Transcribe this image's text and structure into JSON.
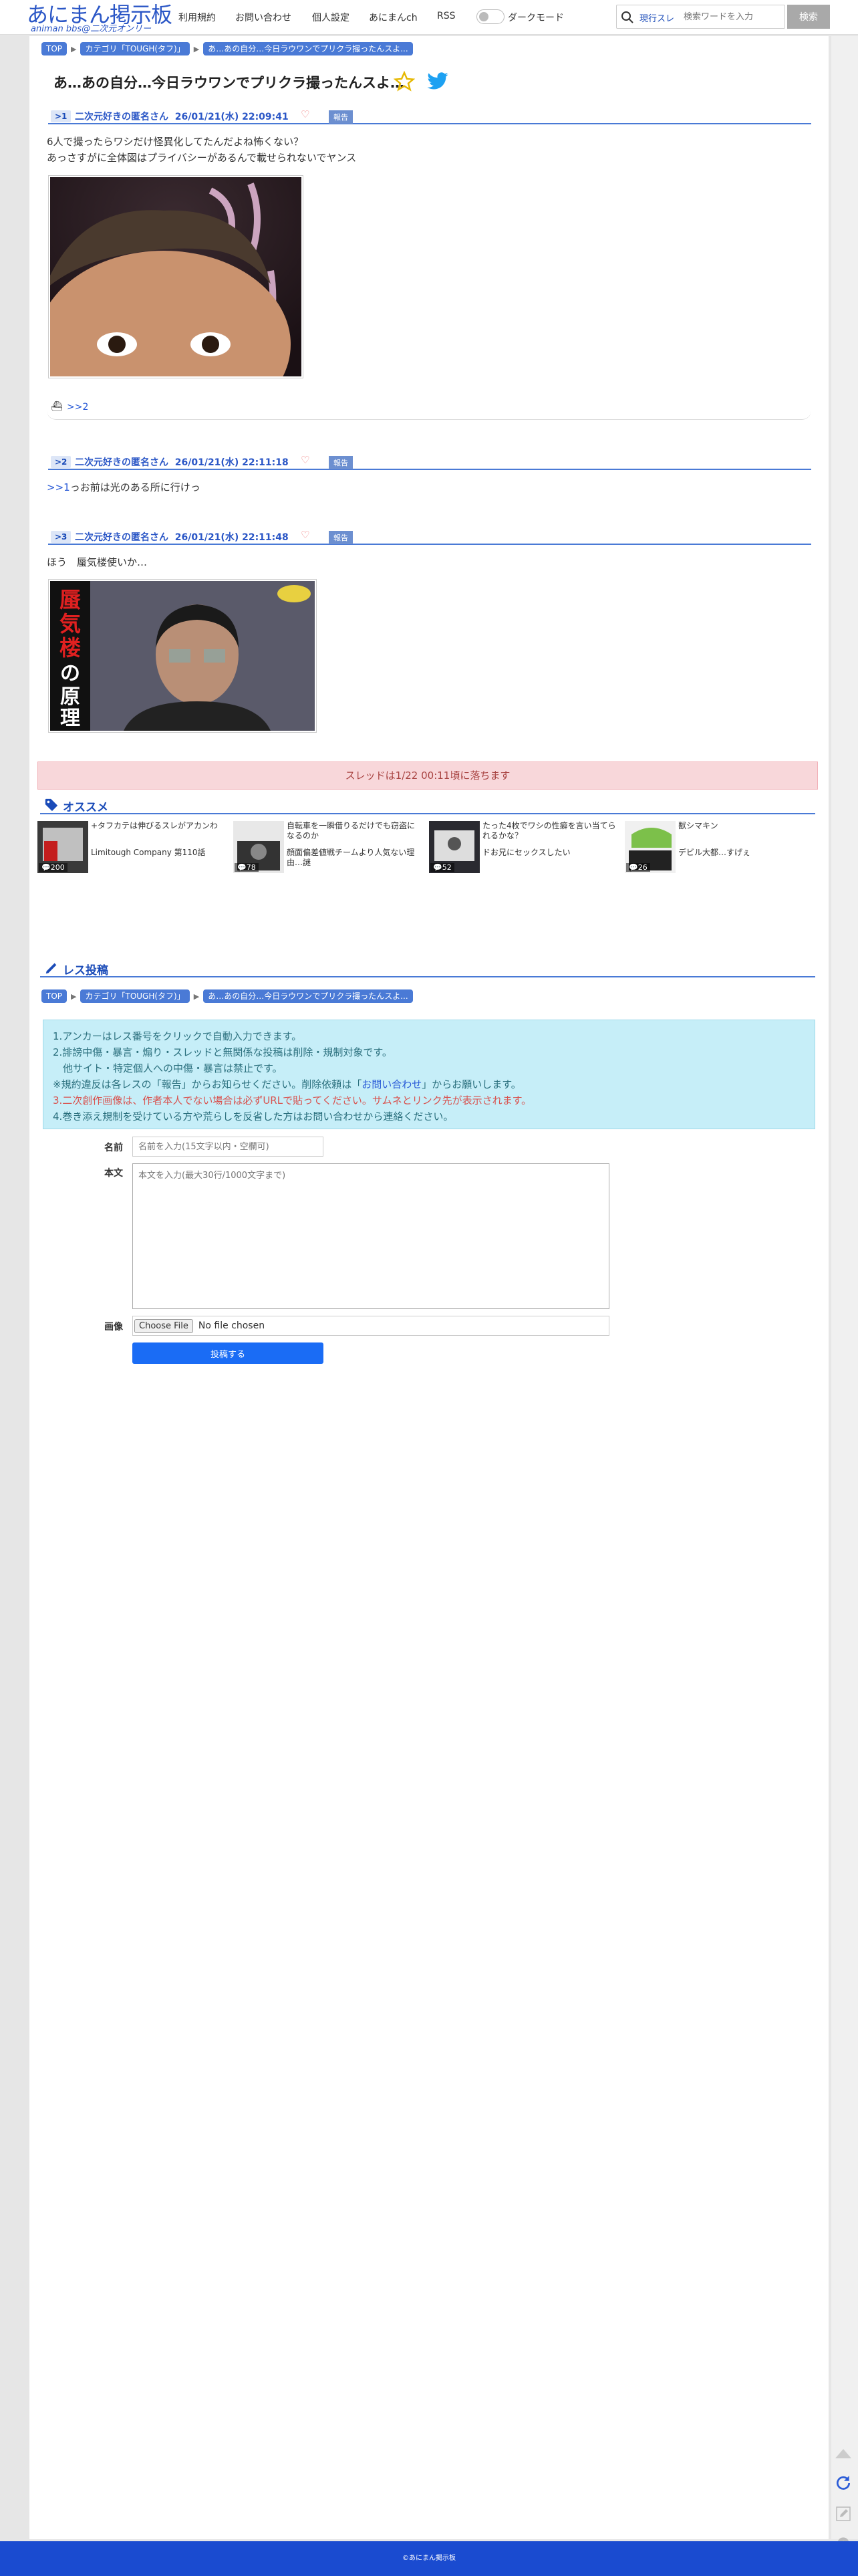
{
  "header": {
    "logo_title": "あにまん掲示板",
    "logo_sub": "animan bbs@二次元オンリー",
    "nav": [
      "利用規約",
      "お問い合わせ",
      "個人設定",
      "あにまんch",
      "RSS"
    ],
    "dark_mode_label": "ダークモード",
    "search_flag": "現行スレ",
    "search_placeholder": "検索ワードを入力",
    "search_button": "検索"
  },
  "breadcrumb": {
    "top": "TOP",
    "category": "カテゴリ「TOUGH(タフ)」",
    "thread": "あ…あの自分…今日ラウワンでプリクラ撮ったんスよ..."
  },
  "thread_title": "あ…あの自分…今日ラウワンでプリクラ撮ったんスよ…",
  "posts": [
    {
      "no": ">1",
      "name": "二次元好きの匿名さん",
      "date": "26/01/21(水) 22:09:41",
      "report": "報告",
      "lines": [
        "6人で撮ったらワシだけ怪異化してたんだよね怖くない？",
        "あっさすがに全体図はプライバシーがあるんで載せられないでヤンス"
      ],
      "reply_link": ">>2"
    },
    {
      "no": ">2",
      "name": "二次元好きの匿名さん",
      "date": "26/01/21(水) 22:11:18",
      "report": "報告",
      "anchor": ">>1",
      "text": "っお前は光のある所に行けっ"
    },
    {
      "no": ">3",
      "name": "二次元好きの匿名さん",
      "date": "26/01/21(水) 22:11:48",
      "report": "報告",
      "text": "ほう　蜃気楼使いか…",
      "image_text": [
        "蜃気楼",
        "の",
        "原理"
      ]
    }
  ],
  "drop_notice": "スレッドは1/22 00:11頃に落ちます",
  "recommend": {
    "heading": "オススメ",
    "items": [
      {
        "title": "+タフカテは伸びるスレがアカンわ",
        "title2": "Limitough Company 第110話",
        "count": "200"
      },
      {
        "title": "自転車を一瞬借りるだけでも窃盗になるのか",
        "title2": "顔面偏差値戦チームより人気ない理由…謎",
        "count": "78"
      },
      {
        "title": "たった4枚でワシの性癖を言い当てられるかな？",
        "title2": "ドお兄にセックスしたい",
        "count": "52"
      },
      {
        "title": "獣シマキン",
        "title2": "デビル大都…すげぇ",
        "count": "26"
      }
    ]
  },
  "reply_form": {
    "heading": "レス投稿",
    "info": [
      "1.アンカーはレス番号をクリックで自動入力できます。",
      "2.誹謗中傷・暴言・煽り・スレッドと無関係な投稿は削除・規制対象です。",
      "　他サイト・特定個人への中傷・暴言は禁止です。",
      "※規約違反は各レスの「報告」からお知らせください。削除依頼は「",
      "お問い合わせ",
      "」からお願いします。",
      "3.二次創作画像は、作者本人でない場合は必ずURLで貼ってください。サムネとリンク先が表示されます。",
      "4.巻き添え規制を受けている方や荒らしを反省した方はお問い合わせから連絡ください。"
    ],
    "name_label": "名前",
    "name_placeholder": "名前を入力(15文字以内・空欄可)",
    "body_label": "本文",
    "body_placeholder": "本文を入力(最大30行/1000文字まで)",
    "image_label": "画像",
    "file_button": "Choose File",
    "file_status": "No file chosen",
    "submit": "投稿する"
  },
  "footer": "©あにまん掲示板",
  "colors": {
    "accent": "#2a56c6",
    "footer": "#1a4bd0",
    "info_bg": "#c6eef8",
    "drop_bg": "#f8d7da"
  }
}
